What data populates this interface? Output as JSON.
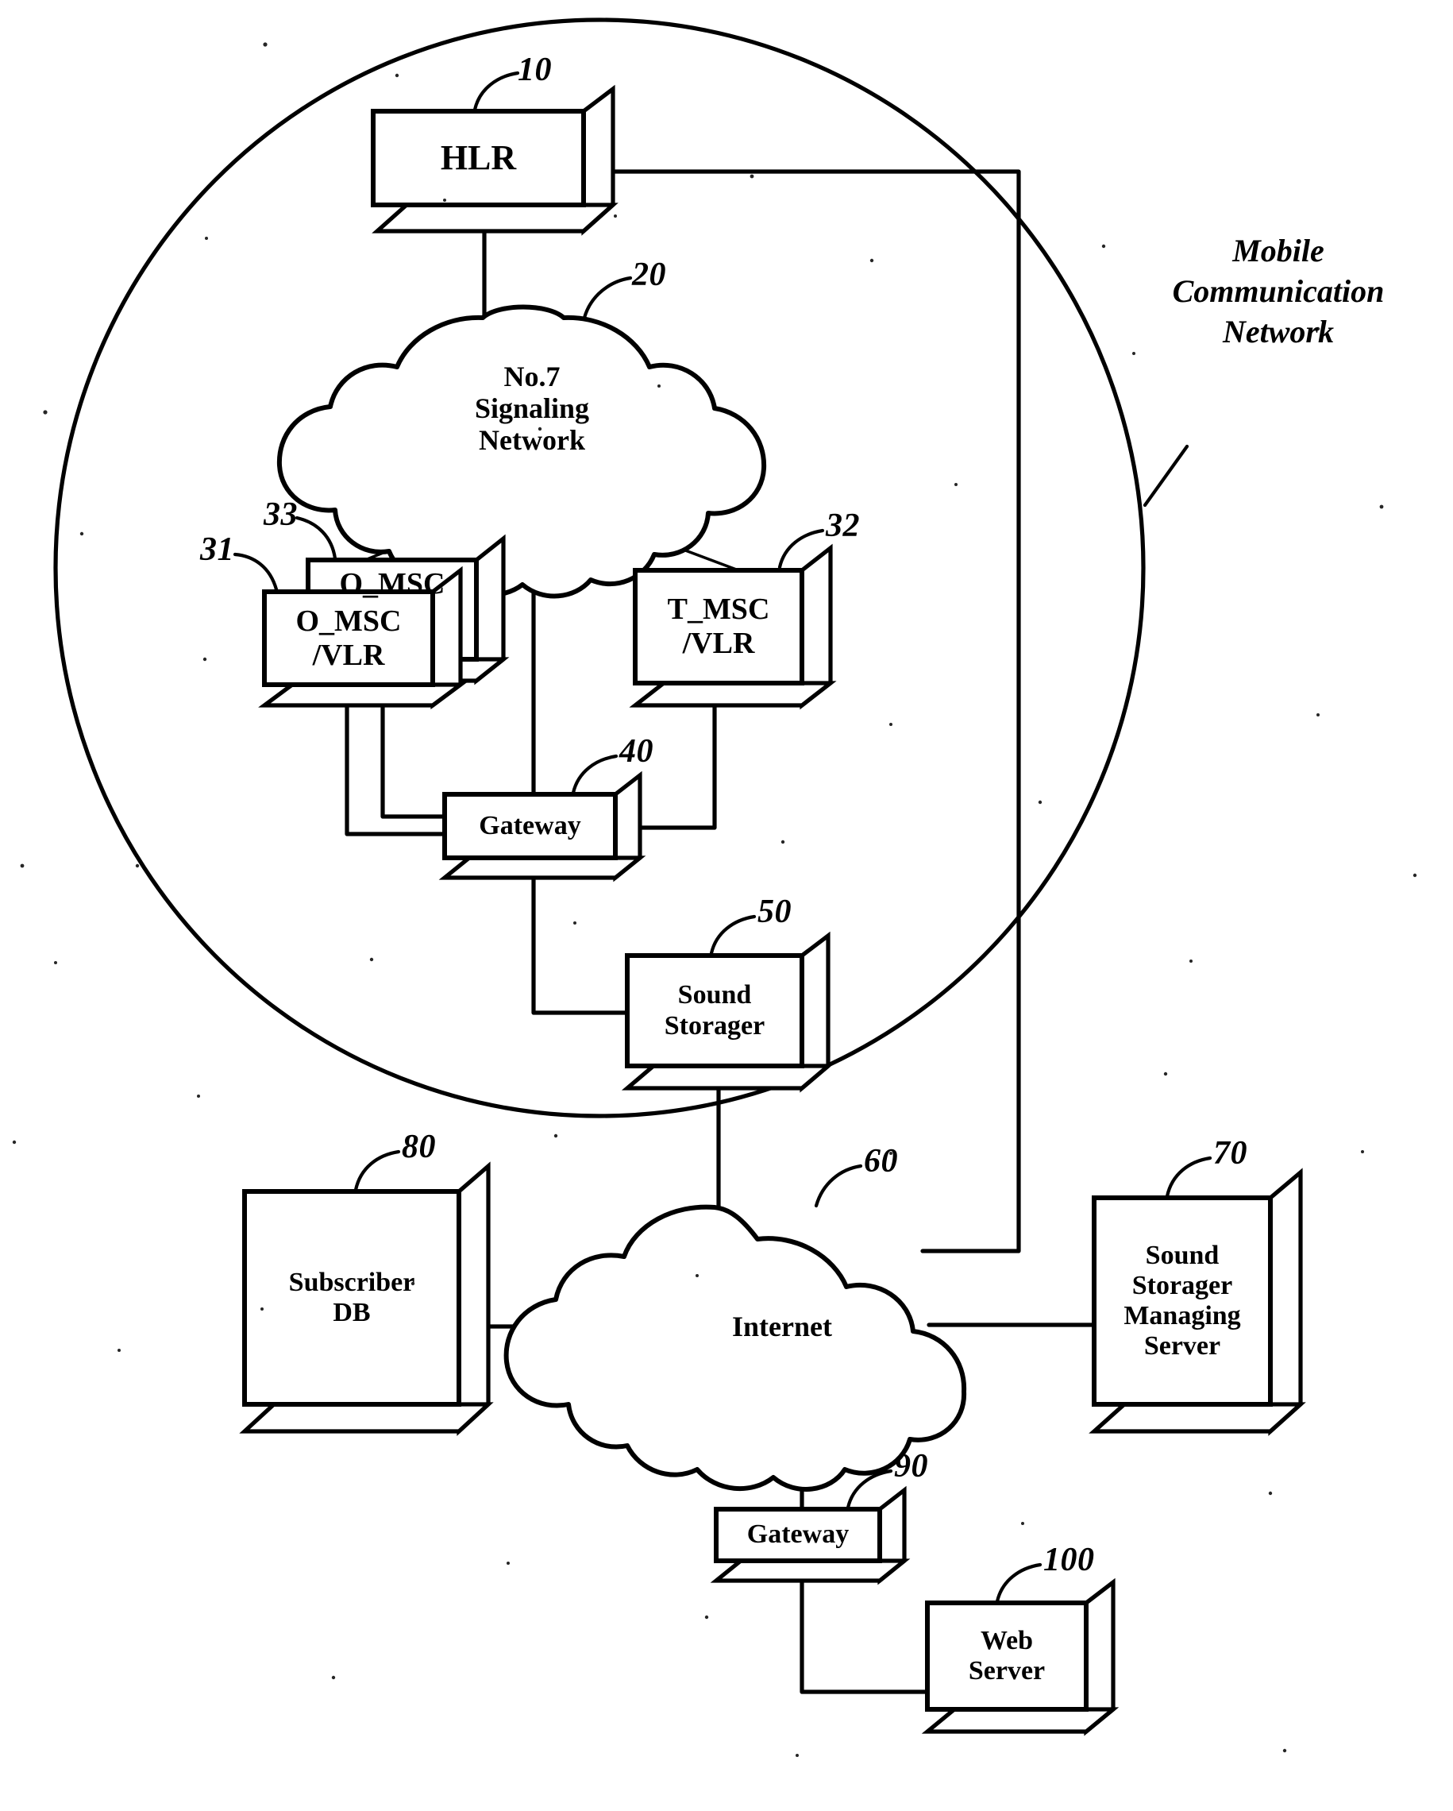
{
  "figure": {
    "domain_kind": "patent-network-diagram",
    "region_caption": "Mobile\nCommunication\nNetwork",
    "region_caption_ref": ""
  },
  "nodes": [
    {
      "id": "hlr",
      "label": "HLR",
      "ref": "10",
      "shape": "box3d"
    },
    {
      "id": "ss7",
      "label": "No.7\nSignaling\nNetwork",
      "ref": "20",
      "shape": "cloud"
    },
    {
      "id": "omsc_back",
      "label": "O_MSC",
      "ref": "33",
      "shape": "box3d"
    },
    {
      "id": "omsc",
      "label": "O_MSC\n/VLR",
      "ref": "31",
      "shape": "box3d"
    },
    {
      "id": "tmsc",
      "label": "T_MSC\n/VLR",
      "ref": "32",
      "shape": "box3d"
    },
    {
      "id": "gateway40",
      "label": "Gateway",
      "ref": "40",
      "shape": "box3d"
    },
    {
      "id": "sound50",
      "label": "Sound\nStorager",
      "ref": "50",
      "shape": "box3d"
    },
    {
      "id": "internet",
      "label": "Internet",
      "ref": "60",
      "shape": "cloud"
    },
    {
      "id": "ssms70",
      "label": "Sound\nStorager\nManaging\nServer",
      "ref": "70",
      "shape": "box3d"
    },
    {
      "id": "subdb80",
      "label": "Subscriber\nDB",
      "ref": "80",
      "shape": "box3d"
    },
    {
      "id": "gateway90",
      "label": "Gateway",
      "ref": "90",
      "shape": "box3d"
    },
    {
      "id": "web100",
      "label": "Web\nServer",
      "ref": "100",
      "shape": "box3d"
    }
  ],
  "colors": {
    "ink": "#000000",
    "paper": "#ffffff"
  }
}
